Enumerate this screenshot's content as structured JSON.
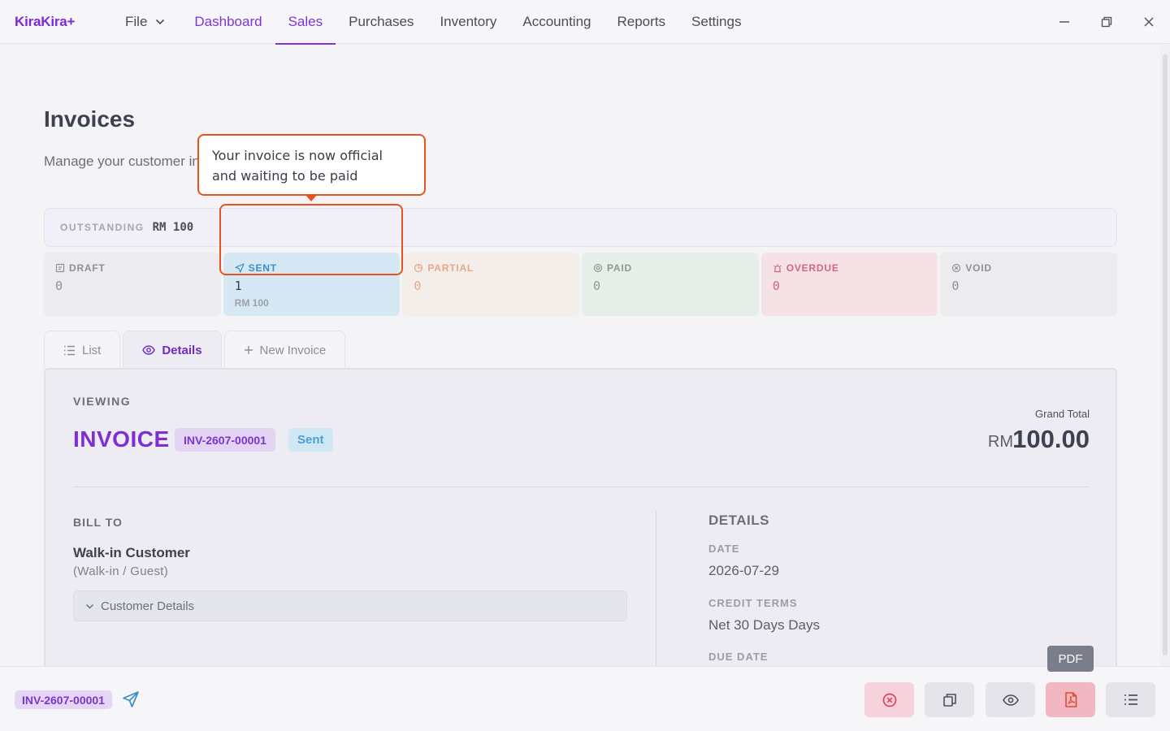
{
  "app": {
    "logo": "KiraKira+"
  },
  "menu": {
    "file": "File",
    "items": [
      "Dashboard",
      "Sales",
      "Purchases",
      "Inventory",
      "Accounting",
      "Reports",
      "Settings"
    ],
    "active": "Sales"
  },
  "page": {
    "title": "Invoices",
    "subtitle": "Manage your customer invoices"
  },
  "outstanding": {
    "label": "OUTSTANDING",
    "value": "RM 100"
  },
  "tooltip": {
    "text": "Your invoice is now official and waiting to be paid"
  },
  "status_cards": [
    {
      "label": "DRAFT",
      "count": "0",
      "amount": ""
    },
    {
      "label": "SENT",
      "count": "1",
      "amount": "RM 100"
    },
    {
      "label": "PARTIAL",
      "count": "0",
      "amount": ""
    },
    {
      "label": "PAID",
      "count": "0",
      "amount": ""
    },
    {
      "label": "OVERDUE",
      "count": "0",
      "amount": ""
    },
    {
      "label": "VOID",
      "count": "0",
      "amount": ""
    }
  ],
  "tabs": {
    "list": "List",
    "details": "Details",
    "new": "New Invoice"
  },
  "invoice": {
    "viewing_label": "VIEWING",
    "title": "INVOICE",
    "number": "INV-2607-00001",
    "status": "Sent",
    "grand_total_label": "Grand Total",
    "currency": "RM",
    "grand_total": "100.00"
  },
  "bill_to": {
    "label": "BILL TO",
    "name": "Walk-in Customer",
    "type": "(Walk-in / Guest)",
    "details_toggle": "Customer Details"
  },
  "details": {
    "title": "DETAILS",
    "date_label": "DATE",
    "date": "2026-07-29",
    "terms_label": "CREDIT TERMS",
    "terms": "Net 30 Days Days",
    "due_label": "DUE DATE"
  },
  "pdf_tooltip": "PDF",
  "bottom": {
    "invoice_number": "INV-2607-00001"
  },
  "colors": {
    "accent": "#7e35d4",
    "highlight": "#e8521f",
    "sent": "#3a8fc9"
  }
}
